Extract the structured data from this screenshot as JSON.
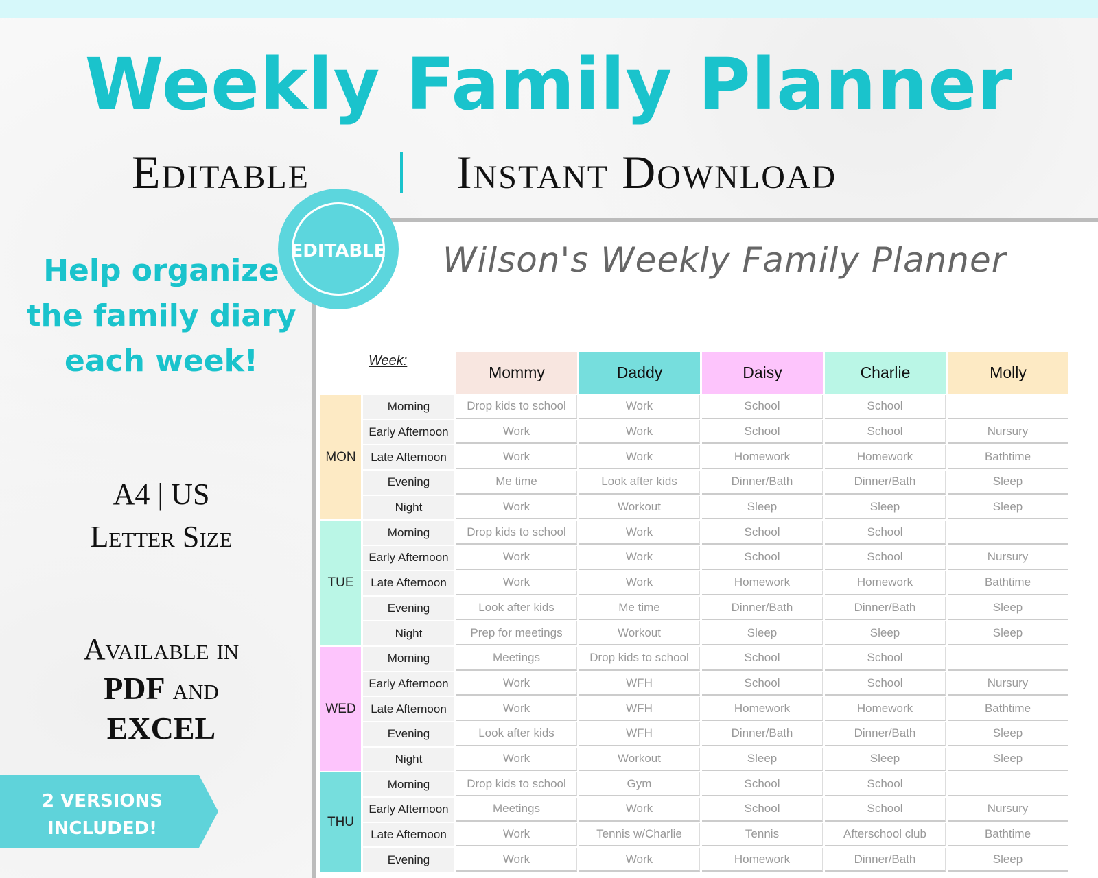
{
  "title": "Weekly Family Planner",
  "subtitle_left": "Editable",
  "subtitle_right": "Instant Download",
  "badge": "EDITABLE",
  "left": {
    "help": "Help organize the family diary each week!",
    "size_line1": "A4 | US",
    "size_line2": "Letter Size",
    "avail_line1": "Available in",
    "avail_pdf": "PDF",
    "avail_and": "and",
    "avail_excel": "EXCEL"
  },
  "ribbon": {
    "line1": "2 VERSIONS",
    "line2": "INCLUDED!"
  },
  "planner": {
    "title": "Wilson's Weekly Family Planner",
    "week_label": "Week:",
    "members": [
      {
        "name": "Mommy",
        "color": "#f8e6e0"
      },
      {
        "name": "Daddy",
        "color": "#76dedd"
      },
      {
        "name": "Daisy",
        "color": "#fdc4fc"
      },
      {
        "name": "Charlie",
        "color": "#baf6e6"
      },
      {
        "name": "Molly",
        "color": "#fdeac4"
      }
    ],
    "slots": [
      "Morning",
      "Early Afternoon",
      "Late Afternoon",
      "Evening",
      "Night"
    ],
    "days": [
      {
        "label": "MON",
        "color": "#fdeac4",
        "rows": [
          [
            "Drop kids to school",
            "Work",
            "School",
            "School",
            ""
          ],
          [
            "Work",
            "Work",
            "School",
            "School",
            "Nursury"
          ],
          [
            "Work",
            "Work",
            "Homework",
            "Homework",
            "Bathtime"
          ],
          [
            "Me time",
            "Look after kids",
            "Dinner/Bath",
            "Dinner/Bath",
            "Sleep"
          ],
          [
            "Work",
            "Workout",
            "Sleep",
            "Sleep",
            "Sleep"
          ]
        ]
      },
      {
        "label": "TUE",
        "color": "#baf6e6",
        "rows": [
          [
            "Drop kids to school",
            "Work",
            "School",
            "School",
            ""
          ],
          [
            "Work",
            "Work",
            "School",
            "School",
            "Nursury"
          ],
          [
            "Work",
            "Work",
            "Homework",
            "Homework",
            "Bathtime"
          ],
          [
            "Look after kids",
            "Me time",
            "Dinner/Bath",
            "Dinner/Bath",
            "Sleep"
          ],
          [
            "Prep for meetings",
            "Workout",
            "Sleep",
            "Sleep",
            "Sleep"
          ]
        ]
      },
      {
        "label": "WED",
        "color": "#fdc4fc",
        "rows": [
          [
            "Meetings",
            "Drop kids to school",
            "School",
            "School",
            ""
          ],
          [
            "Work",
            "WFH",
            "School",
            "School",
            "Nursury"
          ],
          [
            "Work",
            "WFH",
            "Homework",
            "Homework",
            "Bathtime"
          ],
          [
            "Look after kids",
            "WFH",
            "Dinner/Bath",
            "Dinner/Bath",
            "Sleep"
          ],
          [
            "Work",
            "Workout",
            "Sleep",
            "Sleep",
            "Sleep"
          ]
        ]
      },
      {
        "label": "THU",
        "color": "#76dedd",
        "rows": [
          [
            "Drop kids to school",
            "Gym",
            "School",
            "School",
            ""
          ],
          [
            "Meetings",
            "Work",
            "School",
            "School",
            "Nursury"
          ],
          [
            "Work",
            "Tennis w/Charlie",
            "Tennis",
            "Afterschool club",
            "Bathtime"
          ],
          [
            "Work",
            "Work",
            "Homework",
            "Dinner/Bath",
            "Sleep"
          ]
        ]
      }
    ]
  }
}
